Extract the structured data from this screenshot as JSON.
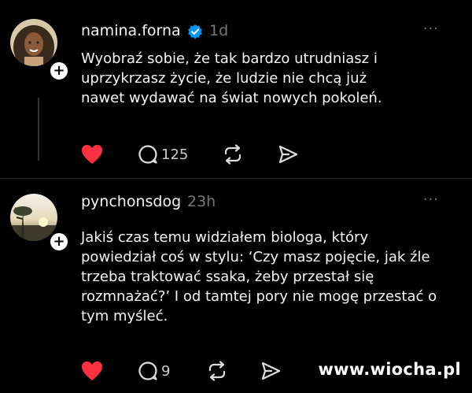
{
  "posts": [
    {
      "username": "namina.forna",
      "verified": true,
      "time": "1d",
      "text": "Wyobraź sobie, że tak bardzo utrudniasz i uprzykrzasz życie, że ludzie nie chcą już nawet wydawać na świat nowych pokoleń.",
      "liked": true,
      "comments": "125",
      "avatar_icon": "profile-photo"
    },
    {
      "username": "pynchonsdog",
      "verified": false,
      "time": "23h",
      "text": "Jakiś czas temu widziałem biologa, który powiedział coś w stylu: ‘Czy masz pojęcie, jak źle trzeba traktować ssaka, żeby przestał się rozmnażać?’ I od tamtej pory nie mogę przestać o tym myśleć.",
      "liked": true,
      "comments": "9",
      "avatar_icon": "landscape-photo"
    }
  ],
  "more_label": "···",
  "watermark": "www.wiocha.pl",
  "colors": {
    "background": "#000000",
    "like_red": "#ff3040",
    "verified_blue": "#0095f6",
    "muted": "#777777"
  }
}
